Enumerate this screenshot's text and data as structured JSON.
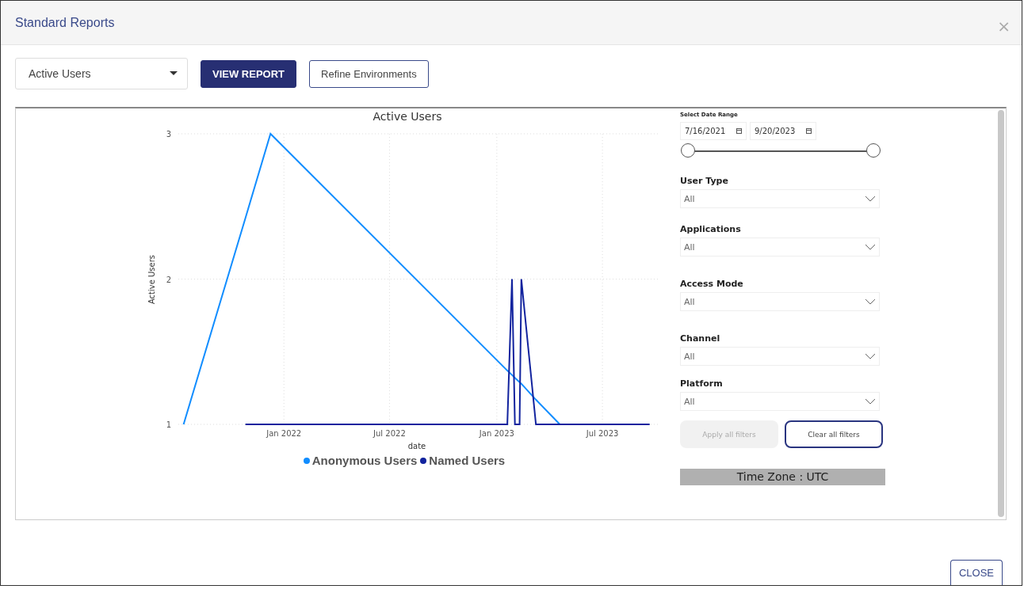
{
  "window": {
    "title": "Standard Reports",
    "close_icon": "×"
  },
  "toolbar": {
    "report_select": {
      "value": "Active Users"
    },
    "buttons": [
      {
        "label": "VIEW REPORT",
        "kind": "primary"
      },
      {
        "label": "Refine Environments",
        "kind": "outline"
      }
    ]
  },
  "chart": {
    "chart_data": {
      "type": "line",
      "grid": true,
      "legend": "bottom",
      "title": "Active Users",
      "xlabel": "date",
      "ylabel": "Active Users",
      "x": [
        "2021-07-13",
        "2021-10-27",
        "2021-12-09",
        "2023-01-19",
        "2023-01-27",
        "2023-02-01",
        "2023-02-09",
        "2023-02-12",
        "2023-03-09",
        "2023-04-19",
        "2023-09-20"
      ],
      "series": [
        {
          "name": "Anonymous Users",
          "color": "#118dff",
          "values": [
            1,
            2.42,
            3,
            1.37,
            1.34,
            1.32,
            1.29,
            1.28,
            1.17,
            1,
            null
          ]
        },
        {
          "name": "Named Users",
          "color": "#12239e",
          "values": [
            null,
            1,
            1,
            1,
            2,
            1,
            1,
            2,
            1,
            1,
            1
          ]
        }
      ],
      "xlim": [
        "2021-07-04",
        "2023-10-04"
      ],
      "ylim": [
        1,
        3
      ],
      "xticks": [
        {
          "value": "2022-01-01",
          "label": "Jan 2022"
        },
        {
          "value": "2022-07-01",
          "label": "Jul 2022"
        },
        {
          "value": "2023-01-01",
          "label": "Jan 2023"
        },
        {
          "value": "2023-07-01",
          "label": "Jul 2023"
        }
      ],
      "yticks": [
        1,
        2,
        3
      ]
    }
  },
  "filters": {
    "date_range": {
      "label": "Select Date Range",
      "start": "7/16/2021",
      "end": "9/20/2023",
      "level": 1
    },
    "slicers": [
      {
        "label": "User Type",
        "value": "All"
      },
      {
        "label": "Applications",
        "value": "All"
      },
      {
        "label": "Access Mode",
        "value": "All"
      },
      {
        "label": "Channel",
        "value": "All"
      },
      {
        "label": "Platform",
        "value": "All"
      }
    ],
    "buttons": [
      {
        "label": "Apply all filters",
        "disabled": true
      },
      {
        "label": "Clear all filters",
        "disabled": false
      }
    ],
    "time_zone": "Time Zone : UTC"
  },
  "footer": {
    "close_button": "CLOSE"
  }
}
